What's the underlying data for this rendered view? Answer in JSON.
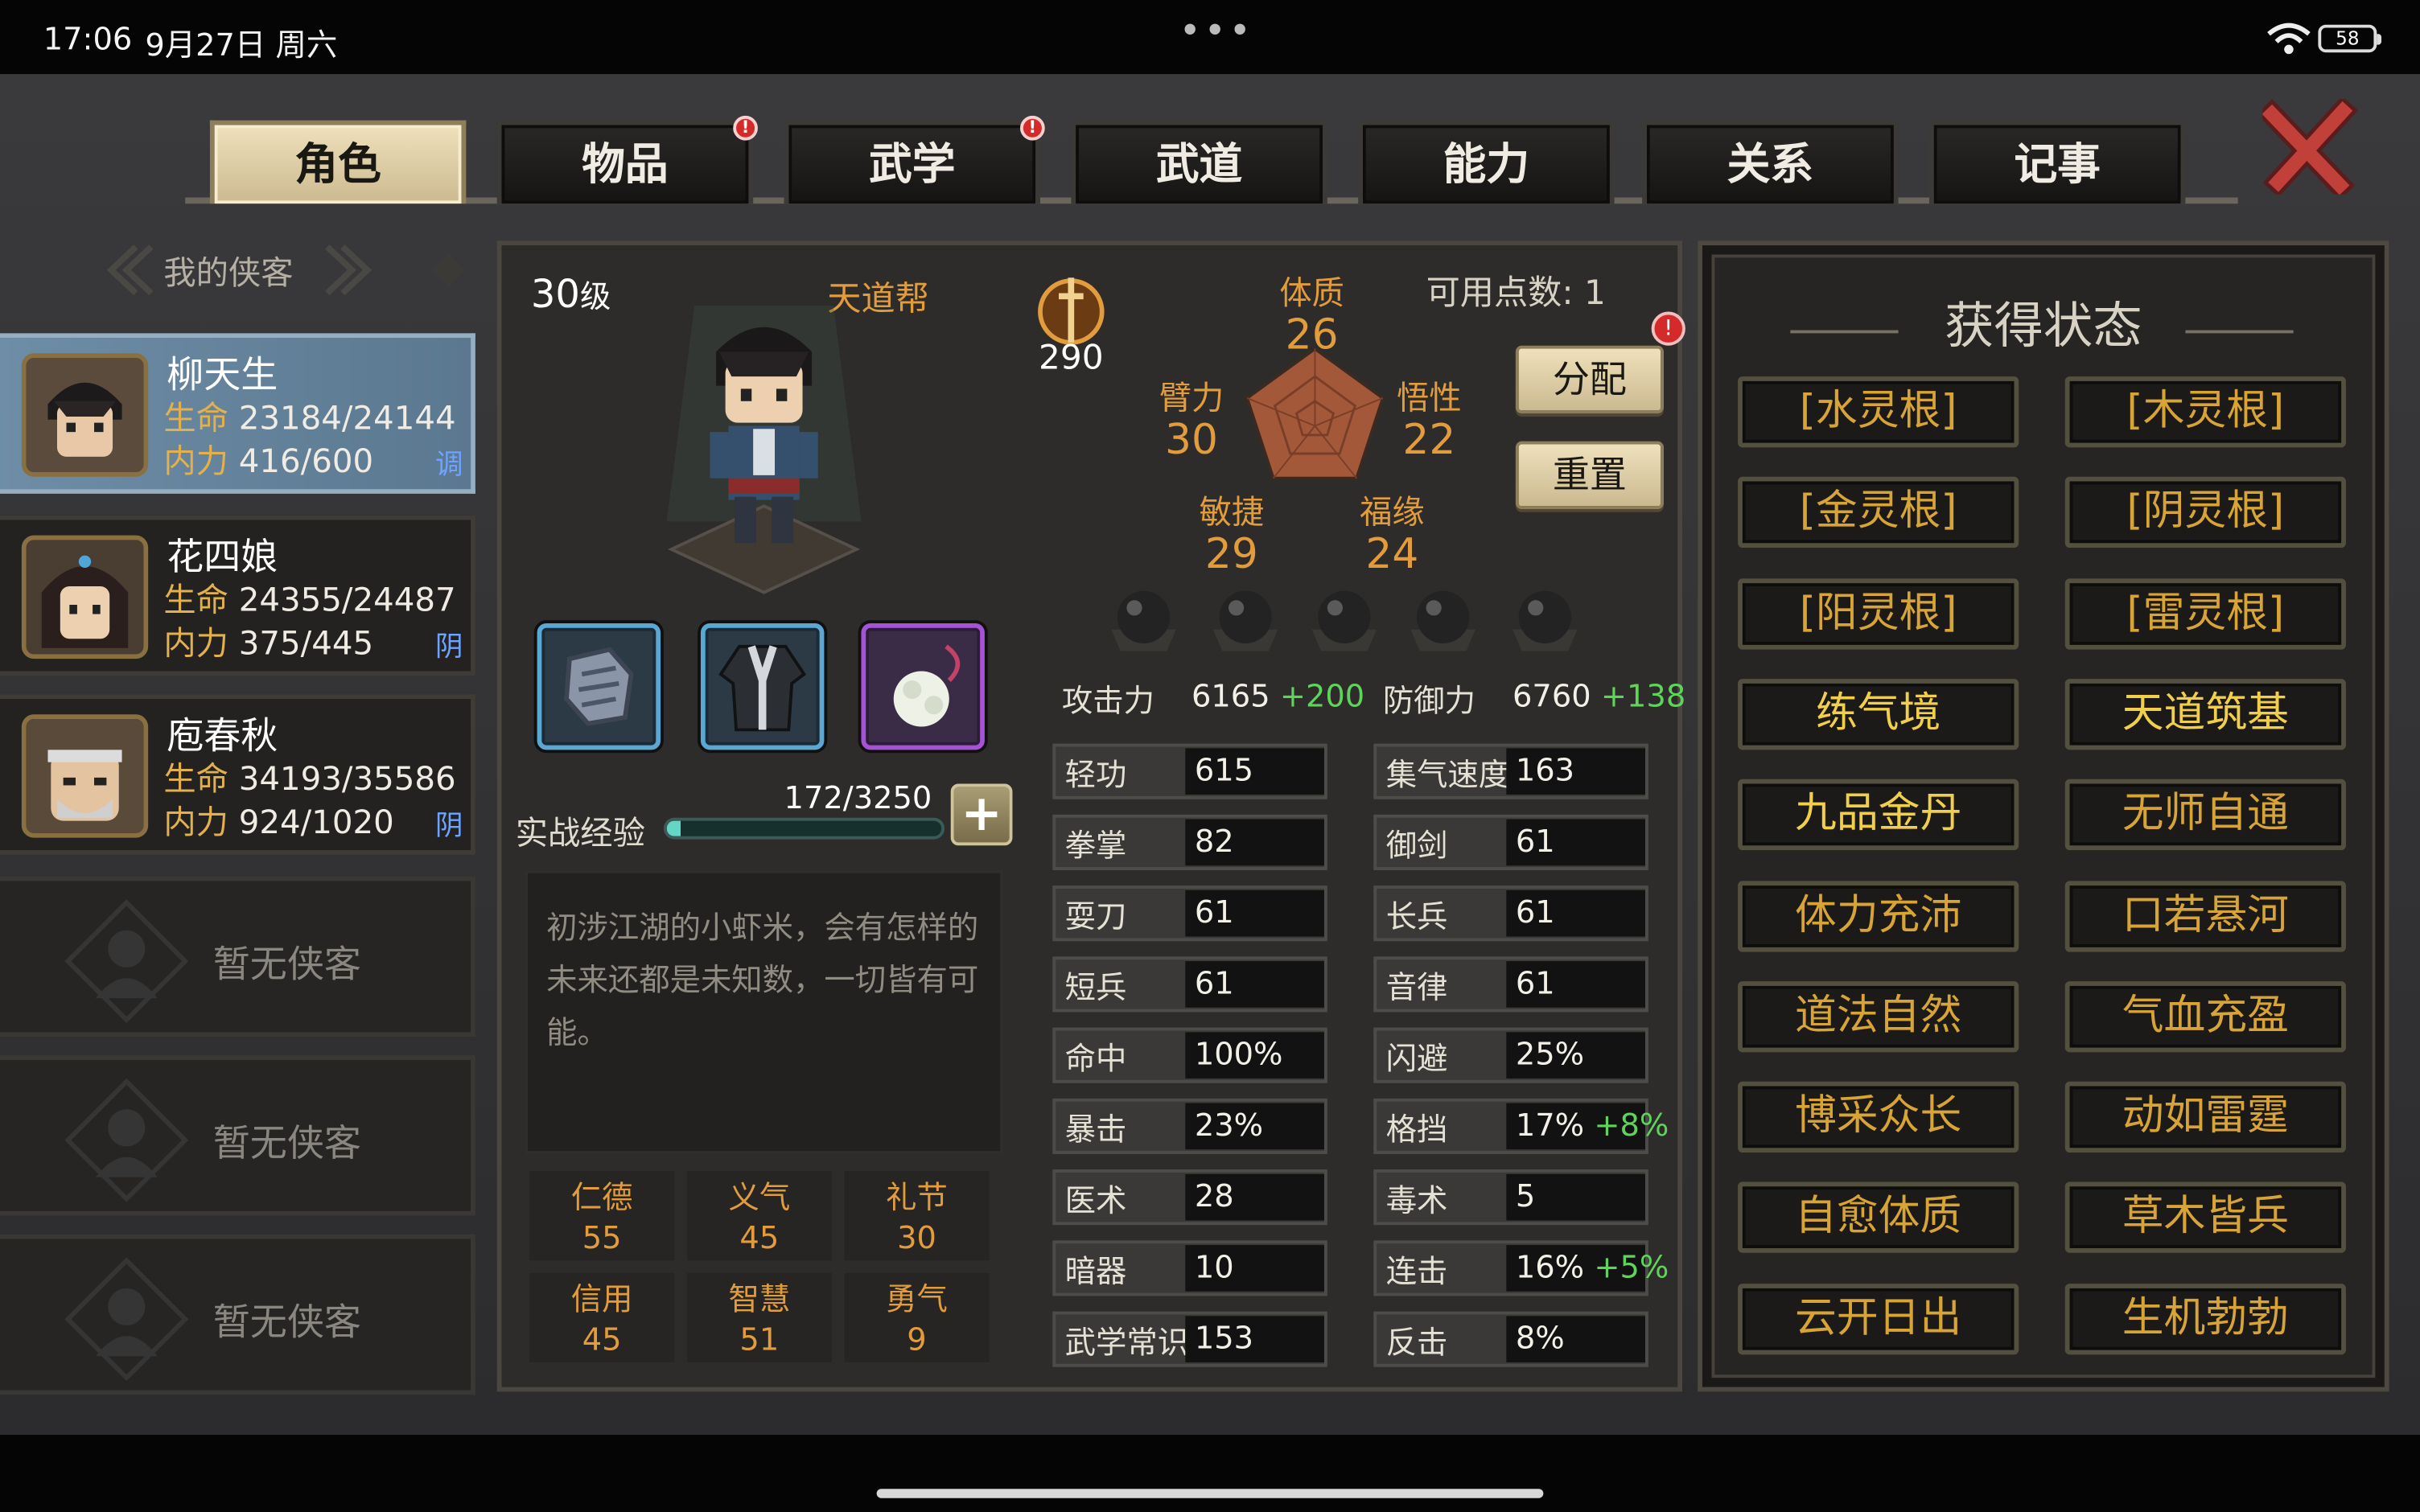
{
  "statusbar": {
    "time": "17:06",
    "date": "9月27日 周六",
    "dots": "•••",
    "battery": "58"
  },
  "tabs": [
    {
      "label": "角色",
      "active": true,
      "badge": ""
    },
    {
      "label": "物品",
      "active": false,
      "badge": "!"
    },
    {
      "label": "武学",
      "active": false,
      "badge": "!"
    },
    {
      "label": "武道",
      "active": false,
      "badge": ""
    },
    {
      "label": "能力",
      "active": false,
      "badge": ""
    },
    {
      "label": "关系",
      "active": false,
      "badge": ""
    },
    {
      "label": "记事",
      "active": false,
      "badge": ""
    }
  ],
  "heroes_header": "我的侠客",
  "heroes": [
    {
      "name": "柳天生",
      "hp_label": "生命",
      "hp": "23184/24144",
      "mp_label": "内力",
      "mp": "416/600",
      "tag": "调",
      "selected": true
    },
    {
      "name": "花四娘",
      "hp_label": "生命",
      "hp": "24355/24487",
      "mp_label": "内力",
      "mp": "375/445",
      "tag": "阴",
      "selected": false
    },
    {
      "name": "庖春秋",
      "hp_label": "生命",
      "hp": "34193/35586",
      "mp_label": "内力",
      "mp": "924/1020",
      "tag": "阴",
      "selected": false
    }
  ],
  "empty_slots": [
    "暂无侠客",
    "暂无侠客",
    "暂无侠客"
  ],
  "character": {
    "level": "30",
    "level_unit": "级",
    "sect": "天道帮",
    "power": "290",
    "attributes": {
      "tizhi": {
        "label": "体质",
        "value": "26"
      },
      "wuxing": {
        "label": "悟性",
        "value": "22"
      },
      "bili": {
        "label": "臂力",
        "value": "30"
      },
      "minjie": {
        "label": "敏捷",
        "value": "29"
      },
      "fuyuan": {
        "label": "福缘",
        "value": "24"
      }
    },
    "points_label": "可用点数:",
    "points": "1",
    "allocate_label": "分配",
    "reset_label": "重置",
    "alert": "!",
    "xp_label": "实战经验",
    "xp_text": "172/3250",
    "xp_fraction": 0.053,
    "xp_plus": "+",
    "description": "初涉江湖的小虾米，会有怎样的未来还都是未知数，一切皆有可能。",
    "virtues": [
      {
        "label": "仁德",
        "value": "55"
      },
      {
        "label": "义气",
        "value": "45"
      },
      {
        "label": "礼节",
        "value": "30"
      },
      {
        "label": "信用",
        "value": "45"
      },
      {
        "label": "智慧",
        "value": "51"
      },
      {
        "label": "勇气",
        "value": "9"
      }
    ]
  },
  "stats_left": [
    {
      "label": "攻击力",
      "value": "6165",
      "bonus": "+200",
      "plain": true
    },
    {
      "label": "轻功",
      "value": "615",
      "bonus": ""
    },
    {
      "label": "拳掌",
      "value": "82",
      "bonus": ""
    },
    {
      "label": "耍刀",
      "value": "61",
      "bonus": ""
    },
    {
      "label": "短兵",
      "value": "61",
      "bonus": ""
    },
    {
      "label": "命中",
      "value": "100%",
      "bonus": ""
    },
    {
      "label": "暴击",
      "value": "23%",
      "bonus": ""
    },
    {
      "label": "医术",
      "value": "28",
      "bonus": ""
    },
    {
      "label": "暗器",
      "value": "10",
      "bonus": ""
    },
    {
      "label": "武学常识",
      "value": "153",
      "bonus": ""
    }
  ],
  "stats_right": [
    {
      "label": "防御力",
      "value": "6760",
      "bonus": "+138",
      "plain": true
    },
    {
      "label": "集气速度",
      "value": "163",
      "bonus": ""
    },
    {
      "label": "御剑",
      "value": "61",
      "bonus": ""
    },
    {
      "label": "长兵",
      "value": "61",
      "bonus": ""
    },
    {
      "label": "音律",
      "value": "61",
      "bonus": ""
    },
    {
      "label": "闪避",
      "value": "25%",
      "bonus": ""
    },
    {
      "label": "格挡",
      "value": "17%",
      "bonus": "+8%"
    },
    {
      "label": "毒术",
      "value": "5",
      "bonus": ""
    },
    {
      "label": "连击",
      "value": "16%",
      "bonus": "+5%"
    },
    {
      "label": "反击",
      "value": "8%",
      "bonus": ""
    }
  ],
  "status_title": "获得状态",
  "statuses": [
    {
      "label": "[水灵根]",
      "style": "dim"
    },
    {
      "label": "[木灵根]",
      "style": "dim"
    },
    {
      "label": "[金灵根]",
      "style": "dim"
    },
    {
      "label": "[阴灵根]",
      "style": "dim"
    },
    {
      "label": "[阳灵根]",
      "style": "dim"
    },
    {
      "label": "[雷灵根]",
      "style": "dim"
    },
    {
      "label": "练气境",
      "style": "gold"
    },
    {
      "label": "天道筑基",
      "style": "gold"
    },
    {
      "label": "九品金丹",
      "style": "gold"
    },
    {
      "label": "无师自通",
      "style": "dim"
    },
    {
      "label": "体力充沛",
      "style": "dim"
    },
    {
      "label": "口若悬河",
      "style": "dim"
    },
    {
      "label": "道法自然",
      "style": "dim"
    },
    {
      "label": "气血充盈",
      "style": "dim"
    },
    {
      "label": "博采众长",
      "style": "dim"
    },
    {
      "label": "动如雷霆",
      "style": "dim"
    },
    {
      "label": "自愈体质",
      "style": "dim"
    },
    {
      "label": "草木皆兵",
      "style": "dim"
    },
    {
      "label": "云开日出",
      "style": "dim"
    },
    {
      "label": "生机勃勃",
      "style": "dim"
    }
  ],
  "colors": {
    "accent_orange": "#e39c3c",
    "bonus_green": "#5fd45a",
    "status_gold": "#f1cf4a",
    "selected_blue": "#6e8da6"
  }
}
